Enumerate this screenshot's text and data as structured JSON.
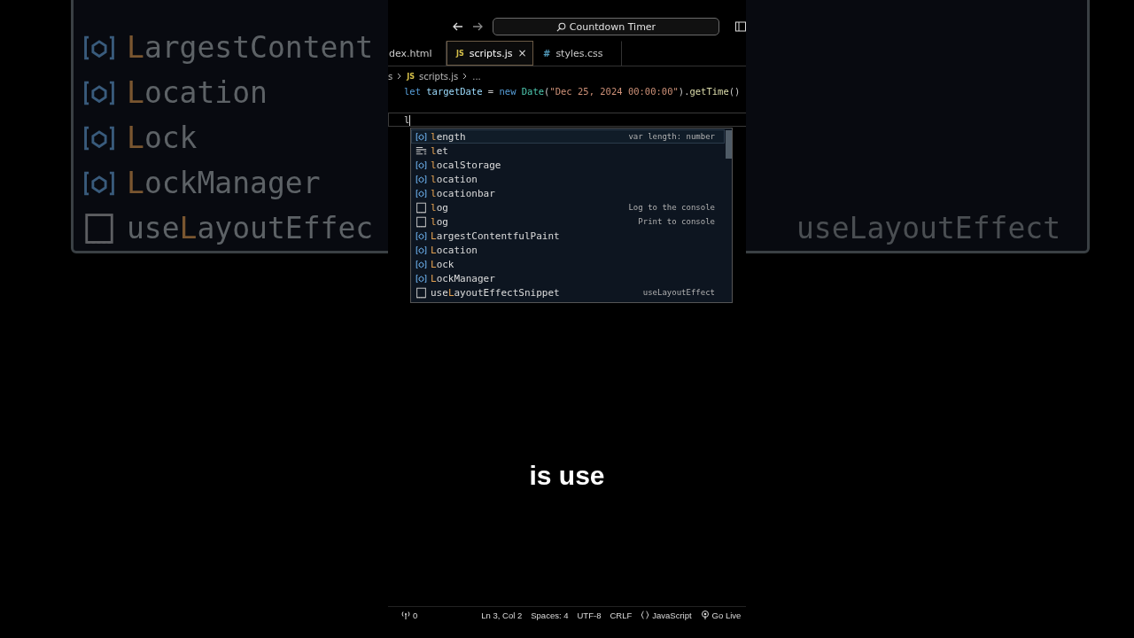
{
  "backdrop": {
    "rows": [
      {
        "kind": "variable",
        "label": "**L**argestContent"
      },
      {
        "kind": "variable",
        "label": "**L**ocation"
      },
      {
        "kind": "variable",
        "label": "**L**ock"
      },
      {
        "kind": "variable",
        "label": "**L**ockManager"
      },
      {
        "kind": "snippet",
        "label": "use**L**ayoutEffec",
        "detail": "useLayoutEffect"
      }
    ]
  },
  "title_bar": {
    "search": "Countdown Timer"
  },
  "tabs": [
    {
      "label": "dex.html",
      "selected": false
    },
    {
      "label": "scripts.js",
      "icon": "JS",
      "selected": true,
      "close": "×"
    },
    {
      "label": "styles.css",
      "icon": "#",
      "selected": false
    }
  ],
  "breadcrumb": {
    "folder": "s",
    "icon": "JS",
    "file": "scripts.js",
    "rest": "..."
  },
  "code_lines": [
    {
      "tokens": [
        {
          "text": "let ",
          "kind": "keyword"
        },
        {
          "text": "targetDate",
          "kind": "variable"
        },
        {
          "text": " = ",
          "kind": "plain"
        },
        {
          "text": "new ",
          "kind": "keyword"
        },
        {
          "text": "Date",
          "kind": "type"
        },
        {
          "text": "(",
          "kind": "plain"
        },
        {
          "text": "\"Dec 25, 2024 00:00:00\"",
          "kind": "string"
        },
        {
          "text": ").",
          "kind": "plain"
        },
        {
          "text": "getTime",
          "kind": "function"
        },
        {
          "text": "()",
          "kind": "plain"
        }
      ],
      "current": false
    },
    {
      "current": false
    },
    {
      "tokens": [
        {
          "text": "l",
          "kind": "plain"
        }
      ],
      "current": true
    }
  ],
  "suggestions": [
    {
      "kind": "variable",
      "label": "**l**ength",
      "detail": "var length: number",
      "selected": true
    },
    {
      "kind": "keyword",
      "label": "**l**et",
      "selected": false
    },
    {
      "kind": "variable",
      "label": "**l**ocalStorage",
      "selected": false
    },
    {
      "kind": "variable",
      "label": "**l**ocation",
      "selected": false
    },
    {
      "kind": "variable",
      "label": "**l**ocationbar",
      "selected": false
    },
    {
      "kind": "snippet",
      "label": "**l**og",
      "detail": "Log to the console",
      "selected": false
    },
    {
      "kind": "snippet",
      "label": "**l**og",
      "detail": "Print to console",
      "selected": false
    },
    {
      "kind": "variable",
      "label": "**L**argestContentfulPaint",
      "selected": false
    },
    {
      "kind": "variable",
      "label": "**L**ocation",
      "selected": false
    },
    {
      "kind": "variable",
      "label": "**L**ock",
      "selected": false
    },
    {
      "kind": "variable",
      "label": "**L**ockManager",
      "selected": false
    },
    {
      "kind": "snippet",
      "label": "use**L**ayoutEffectSnippet",
      "detail": "useLayoutEffect",
      "selected": false
    }
  ],
  "caption": "is use",
  "status_bar": {
    "ports": "0",
    "items": [
      "Ln 3, Col 2",
      "Spaces: 4",
      "UTF-8",
      "CRLF"
    ],
    "language": "JavaScript",
    "go_live": "Go Live"
  }
}
